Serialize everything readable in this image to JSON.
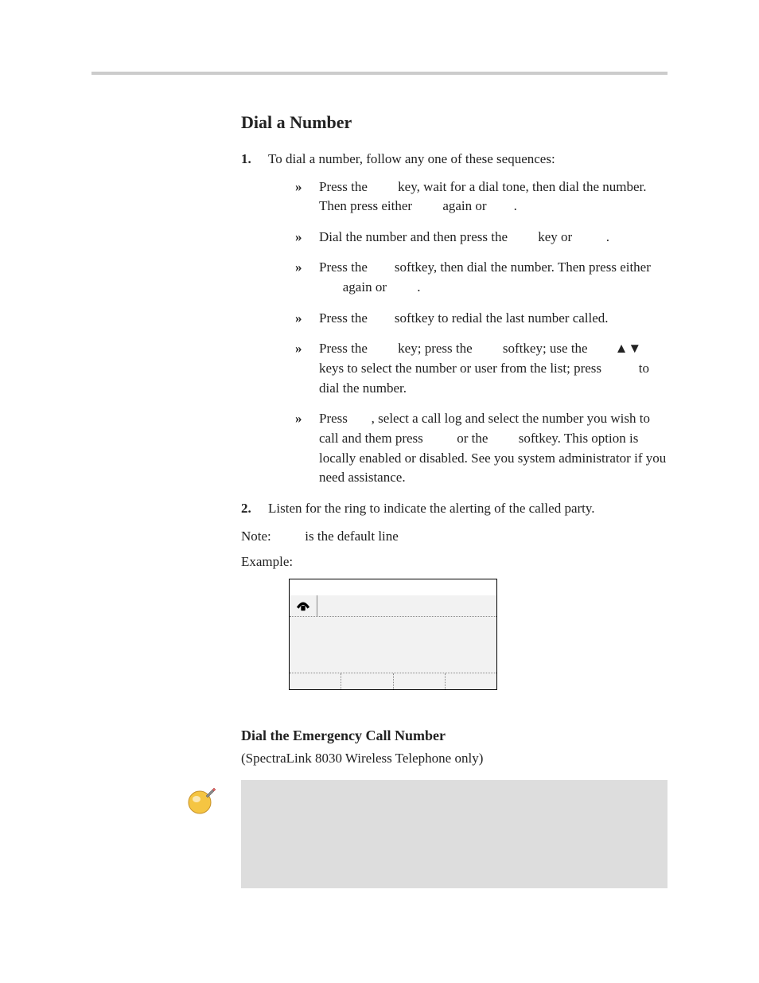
{
  "section_title": "Dial a Number",
  "step1_intro": "To dial a number, follow any one of these sequences:",
  "seq": {
    "a": {
      "p1": "Press the ",
      "p2": " key, wait for a dial tone, then dial the number. Then press either ",
      "p3": " again or ",
      "p4": "."
    },
    "b": {
      "p1": "Dial the number and then press the ",
      "p2": " key or ",
      "p3": "."
    },
    "c": {
      "p1": "Press the ",
      "p2": " softkey, then dial the number. Then press either ",
      "p3": " again or ",
      "p4": "."
    },
    "d": {
      "p1": "Press the ",
      "p2": " softkey to redial the last number called."
    },
    "e": {
      "p1": "Press the ",
      "p2": " key; press the ",
      "p3": " softkey; use the ",
      "arrows": "▲▼",
      "p4": " keys to select the number or user from the list; press ",
      "p5": " to dial the number."
    },
    "f": {
      "p1": "Press ",
      "p2": ", select a call log and select the number you wish to call and them press ",
      "p3": " or the ",
      "p4": " softkey. This option is locally enabled or disabled. See you system administrator if you need assistance."
    }
  },
  "step2": "Listen for the ring to indicate the alerting of the called party.",
  "note_line": {
    "p1": "Note: ",
    "p2": " is the default line"
  },
  "example_label": "Example:",
  "phone_icon": "☎",
  "section2_title": "Dial the Emergency Call Number",
  "section2_sub": "(SpectraLink 8030 Wireless Telephone only)",
  "note_box": ""
}
